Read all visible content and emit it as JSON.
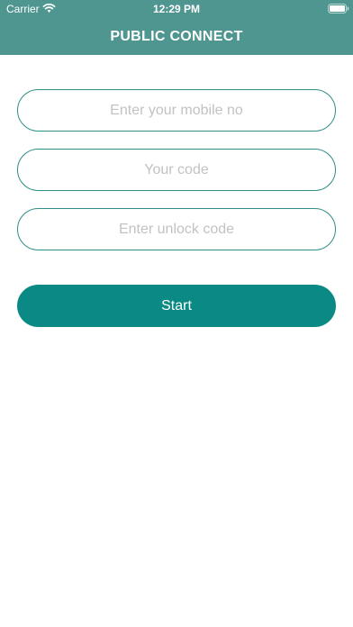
{
  "status_bar": {
    "carrier": "Carrier",
    "time": "12:29 PM"
  },
  "header": {
    "title": "PUBLIC CONNECT",
    "color": "#4f9690"
  },
  "form": {
    "mobile_placeholder": "Enter your mobile no",
    "code_placeholder": "Your code",
    "unlock_placeholder": "Enter unlock code",
    "start_label": "Start",
    "accent_color": "#0b8a85"
  }
}
